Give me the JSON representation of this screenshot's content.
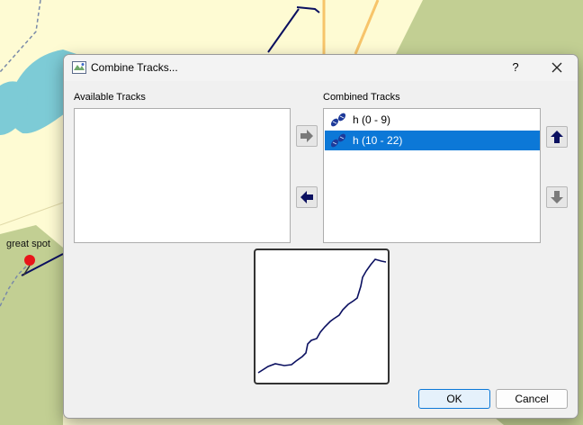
{
  "map": {
    "marker_label": "great spot"
  },
  "dialog": {
    "title": "Combine Tracks...",
    "help_label": "?",
    "available_label": "Available Tracks",
    "combined_label": "Combined Tracks",
    "available_tracks": [],
    "combined_tracks": [
      {
        "label": "h (0 - 9)",
        "selected": false
      },
      {
        "label": "h (10 - 22)",
        "selected": true
      }
    ],
    "ok_label": "OK",
    "cancel_label": "Cancel"
  },
  "colors": {
    "selection": "#0c78d7",
    "track_line": "#0b1060",
    "map_land": "#fefbd3",
    "map_green": "#c2cf93",
    "map_water": "#7dcbd6"
  }
}
